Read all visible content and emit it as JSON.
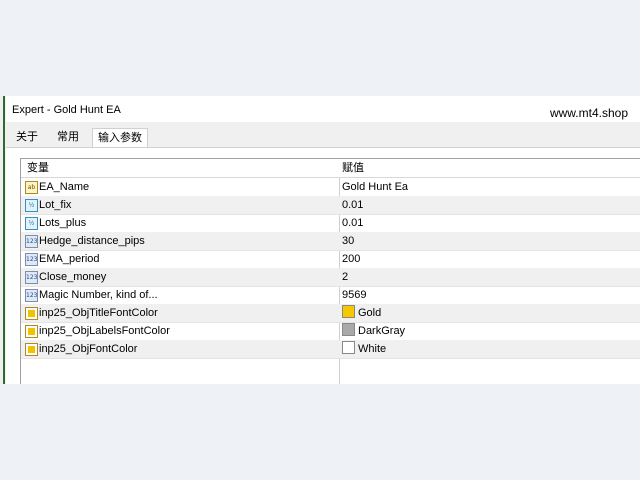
{
  "window": {
    "title": "Expert - Gold Hunt EA",
    "site": "www.mt4.shop"
  },
  "tabs": [
    {
      "label": "关于"
    },
    {
      "label": "常用"
    },
    {
      "label": "输入参数"
    }
  ],
  "table": {
    "headers": {
      "variable": "变量",
      "value": "赋值"
    },
    "rows": [
      {
        "icon": "string-icon",
        "name": "EA_Name",
        "value": "Gold Hunt Ea"
      },
      {
        "icon": "double-icon",
        "name": "Lot_fix",
        "value": "0.01"
      },
      {
        "icon": "double-icon",
        "name": "Lots_plus",
        "value": "0.01"
      },
      {
        "icon": "integer-icon",
        "name": "Hedge_distance_pips",
        "value": "30"
      },
      {
        "icon": "integer-icon",
        "name": "EMA_period",
        "value": "200"
      },
      {
        "icon": "integer-icon",
        "name": "Close_money",
        "value": "2"
      },
      {
        "icon": "integer-icon",
        "name": "Magic Number, kind of...",
        "value": "9569"
      },
      {
        "icon": "color-icon",
        "name": "inp25_ObjTitleFontColor",
        "value": "Gold",
        "swatch": "#f5c800"
      },
      {
        "icon": "color-icon",
        "name": "inp25_ObjLabelsFontColor",
        "value": "DarkGray",
        "swatch": "#a9a9a9"
      },
      {
        "icon": "color-icon",
        "name": "inp25_ObjFontColor",
        "value": "White",
        "swatch": "#ffffff"
      }
    ]
  }
}
